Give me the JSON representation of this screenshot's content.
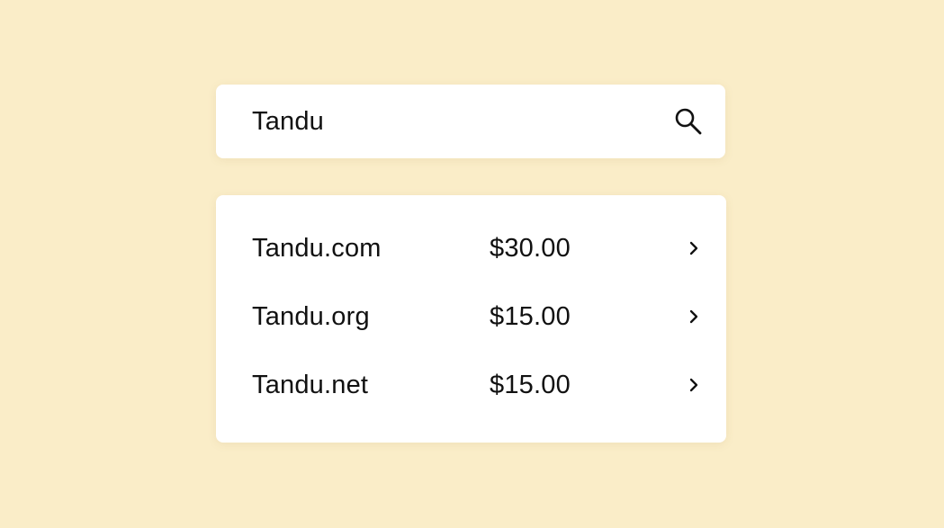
{
  "search": {
    "query": "Tandu",
    "icon": "search-icon"
  },
  "results": [
    {
      "domain": "Tandu.com",
      "price": "$30.00",
      "icon": "chevron-right-icon"
    },
    {
      "domain": "Tandu.org",
      "price": "$15.00",
      "icon": "chevron-right-icon"
    },
    {
      "domain": "Tandu.net",
      "price": "$15.00",
      "icon": "chevron-right-icon"
    }
  ],
  "colors": {
    "background": "#FAEDC8",
    "card": "#FFFFFF",
    "text": "#111111"
  }
}
